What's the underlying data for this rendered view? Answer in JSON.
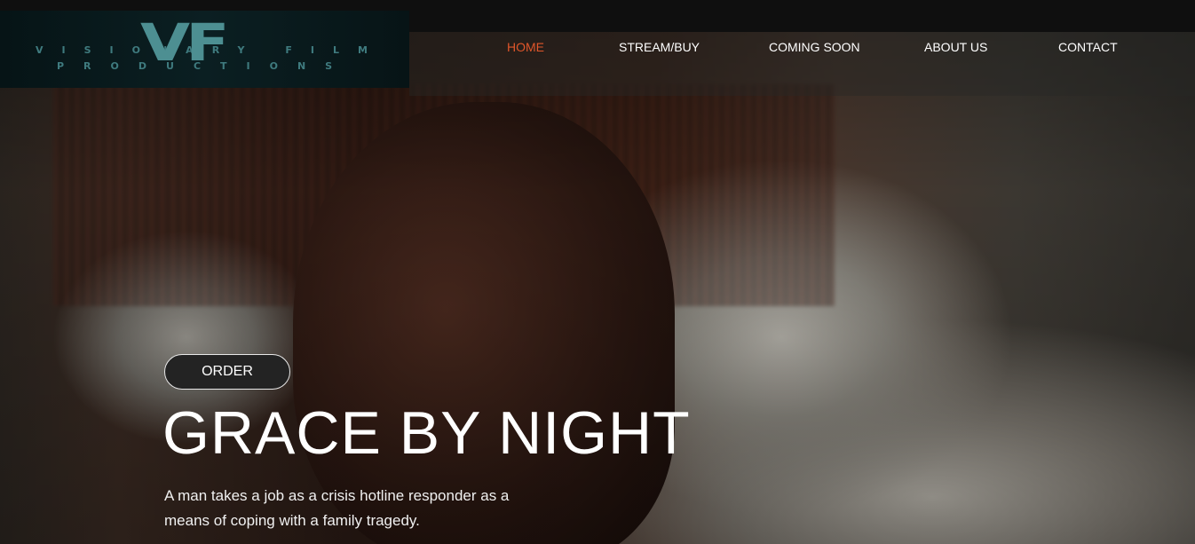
{
  "logo": {
    "mark": "VF",
    "line1": "VISIONARY FILM",
    "line2": "PRODUCTIONS"
  },
  "nav": {
    "items": [
      {
        "label": "HOME",
        "active": true
      },
      {
        "label": "STREAM/BUY",
        "active": false
      },
      {
        "label": "COMING SOON",
        "active": false
      },
      {
        "label": "ABOUT US",
        "active": false
      },
      {
        "label": "CONTACT",
        "active": false
      }
    ]
  },
  "hero": {
    "order_label": "ORDER",
    "title": "GRACE BY NIGHT",
    "description": "A man takes a job as a crisis hotline responder as a means of coping with a family tragedy."
  },
  "colors": {
    "accent": "#e0562a",
    "logo": "#4d8f92",
    "topbar": "#0f0f0f"
  }
}
